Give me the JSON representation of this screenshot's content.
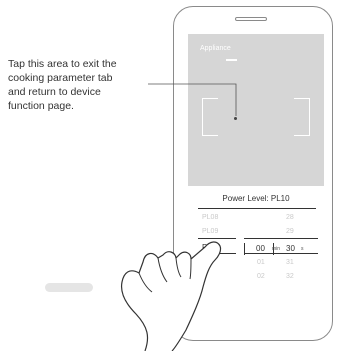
{
  "instruction": {
    "lines": [
      "Tap this area to exit the",
      "cooking parameter tab",
      "and return to device",
      "function page."
    ]
  },
  "screen": {
    "app_title": "Appliance",
    "power_level_label": "Power Level: PL10",
    "power_levels": [
      "PL08",
      "PL09",
      "PL10"
    ],
    "minute_values": [
      "00",
      "01",
      "02"
    ],
    "minute_unit": "min",
    "second_values": [
      "28",
      "29",
      "30",
      "31",
      "32"
    ],
    "second_unit": "s"
  },
  "colors": {
    "preview_bg": "#d6d6d6",
    "text": "#333333",
    "inactive_text": "#c9c9c9"
  }
}
